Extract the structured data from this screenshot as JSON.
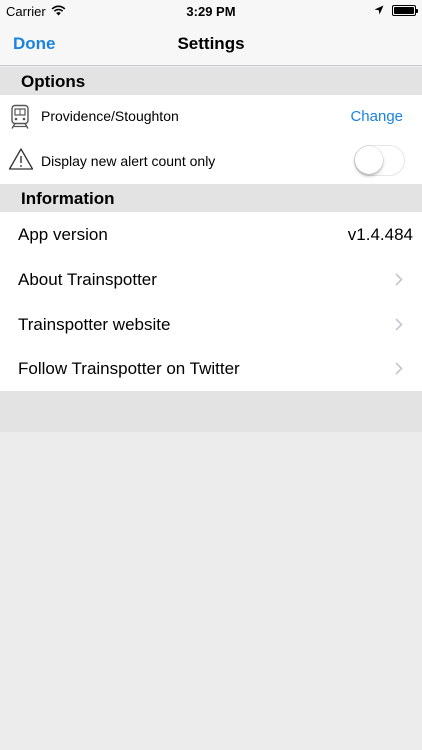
{
  "status_bar": {
    "carrier": "Carrier",
    "time": "3:29 PM",
    "icons": [
      "wifi-icon",
      "location-arrow-icon",
      "battery-icon"
    ]
  },
  "nav": {
    "done_label": "Done",
    "title": "Settings"
  },
  "options": {
    "header": "Options",
    "line": {
      "icon": "train-icon",
      "label": "Providence/Stoughton",
      "action": "Change"
    },
    "alert": {
      "icon": "warning-icon",
      "label": "Display new alert count only",
      "toggle_on": false
    }
  },
  "information": {
    "header": "Information",
    "rows": [
      {
        "label": "App version",
        "value": "v1.4.484"
      },
      {
        "label": "About Trainspotter",
        "icon": "chevron-right-icon"
      },
      {
        "label": "Trainspotter website",
        "icon": "chevron-right-icon"
      },
      {
        "label": "Follow Trainspotter on Twitter",
        "icon": "chevron-right-icon"
      }
    ]
  },
  "colors": {
    "accent": "#1a82e2",
    "section_bg": "#e3e3e3",
    "background": "#ececec"
  }
}
